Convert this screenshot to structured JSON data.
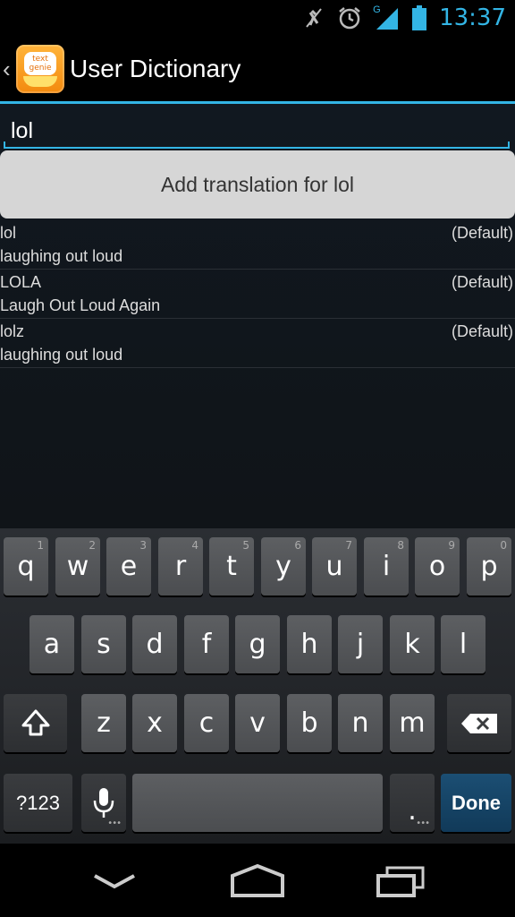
{
  "status_bar": {
    "time": "13:37",
    "icons": [
      "vibrate-off-icon",
      "alarm-icon",
      "signal-icon",
      "battery-icon"
    ],
    "network_label": "G",
    "accent": "#33b5e5"
  },
  "action_bar": {
    "title": "User Dictionary",
    "app_icon_text": "text genie"
  },
  "search": {
    "value": "lol"
  },
  "add_button": {
    "label": "Add translation for lol"
  },
  "entries": [
    {
      "word": "lol",
      "meaning": "laughing out loud",
      "locale": "(Default)"
    },
    {
      "word": "LOLA",
      "meaning": "Laugh Out Loud Again",
      "locale": "(Default)"
    },
    {
      "word": "lolz",
      "meaning": "laughing out loud",
      "locale": "(Default)"
    }
  ],
  "keyboard": {
    "row1": [
      {
        "label": "q",
        "hint": "1"
      },
      {
        "label": "w",
        "hint": "2"
      },
      {
        "label": "e",
        "hint": "3"
      },
      {
        "label": "r",
        "hint": "4"
      },
      {
        "label": "t",
        "hint": "5"
      },
      {
        "label": "y",
        "hint": "6"
      },
      {
        "label": "u",
        "hint": "7"
      },
      {
        "label": "i",
        "hint": "8"
      },
      {
        "label": "o",
        "hint": "9"
      },
      {
        "label": "p",
        "hint": "0"
      }
    ],
    "row2": [
      "a",
      "s",
      "d",
      "f",
      "g",
      "h",
      "j",
      "k",
      "l"
    ],
    "row3": [
      "z",
      "x",
      "c",
      "v",
      "b",
      "n",
      "m"
    ],
    "symbols_label": "?123",
    "period_label": ".",
    "done_label": "Done"
  },
  "nav_bar": {
    "buttons": [
      "back-icon",
      "home-icon",
      "recents-icon"
    ]
  }
}
